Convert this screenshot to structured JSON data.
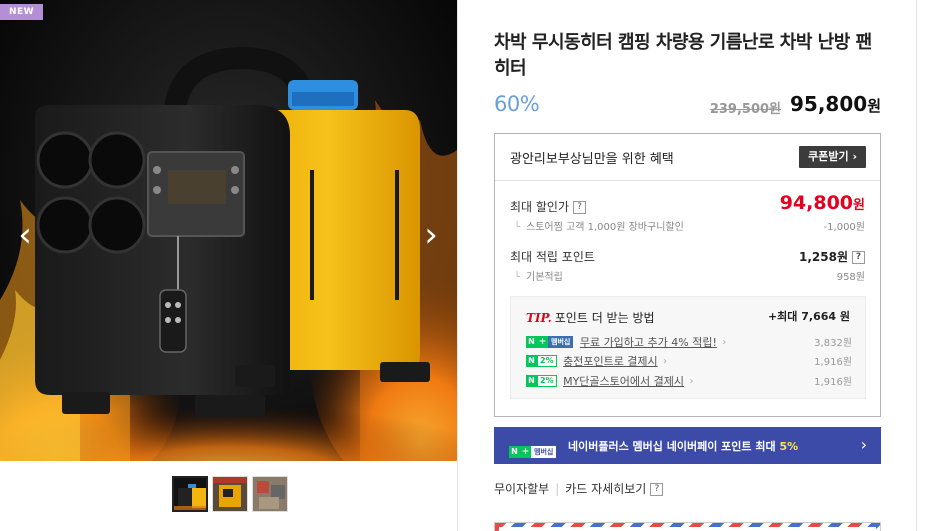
{
  "gallery": {
    "badge": "NEW",
    "prev_icon": "‹",
    "next_icon": "›",
    "thumbnails": [
      {
        "name": "thumb-1",
        "active": true
      },
      {
        "name": "thumb-2",
        "active": false
      },
      {
        "name": "thumb-3",
        "active": false
      }
    ]
  },
  "product": {
    "title": "차박 무시동히터 캠핑 차량용 기름난로 차박 난방 팬 히터",
    "discount": "60%",
    "original_price": "239,500원",
    "sale_price": "95,800",
    "currency": "원"
  },
  "benefit": {
    "title": "광안리보부상님만을 위한 혜택",
    "coupon_button": "쿠폰받기 ›",
    "max_discount_label": "최대 할인가",
    "help": "?",
    "max_discount_price": "94,800",
    "max_discount_currency": "원",
    "store_discount_label": "스토어찜 고객 1,000원 장바구니할인",
    "store_discount_value": "-1,000원",
    "max_points_label": "최대 적립 포인트",
    "max_points_value": "1,258원",
    "basic_points_label": "기본적립",
    "basic_points_value": "958원",
    "elbow": "└"
  },
  "tip": {
    "mark": "TIP.",
    "title": "포인트 더 받는 방법",
    "max": "+최대 7,664 원",
    "lines": [
      {
        "badge_type": "membership",
        "n": "N",
        "plus": "+",
        "mem": "멤버십",
        "pct": "",
        "text": "무료 가입하고 추가 4% 적립!",
        "chev": "›",
        "value": "3,832원"
      },
      {
        "badge_type": "pct",
        "n": "N",
        "plus": "",
        "mem": "",
        "pct": "2%",
        "text": "충전포인트로 결제시",
        "chev": "›",
        "value": "1,916원"
      },
      {
        "badge_type": "pct",
        "n": "N",
        "plus": "",
        "mem": "",
        "pct": "2%",
        "text": "MY단골스토어에서 결제시",
        "chev": "›",
        "value": "1,916원"
      }
    ]
  },
  "naver_bar": {
    "n": "N",
    "plus": "+",
    "mem": "멤버십",
    "text_prefix": "네이버플러스 멤버십 네이버페이 포인트 최대 ",
    "text_highlight": "5%",
    "chevron": "›"
  },
  "links": {
    "installment": "무이자할부",
    "card_detail": "카드 자세히보기",
    "help": "?"
  },
  "colors": {
    "accent_red": "#e4001e",
    "discount_blue": "#6aa0d8",
    "naver_green": "#03c75a",
    "naver_bar_bg": "#3c4ba8",
    "new_badge": "#b58fd6"
  }
}
